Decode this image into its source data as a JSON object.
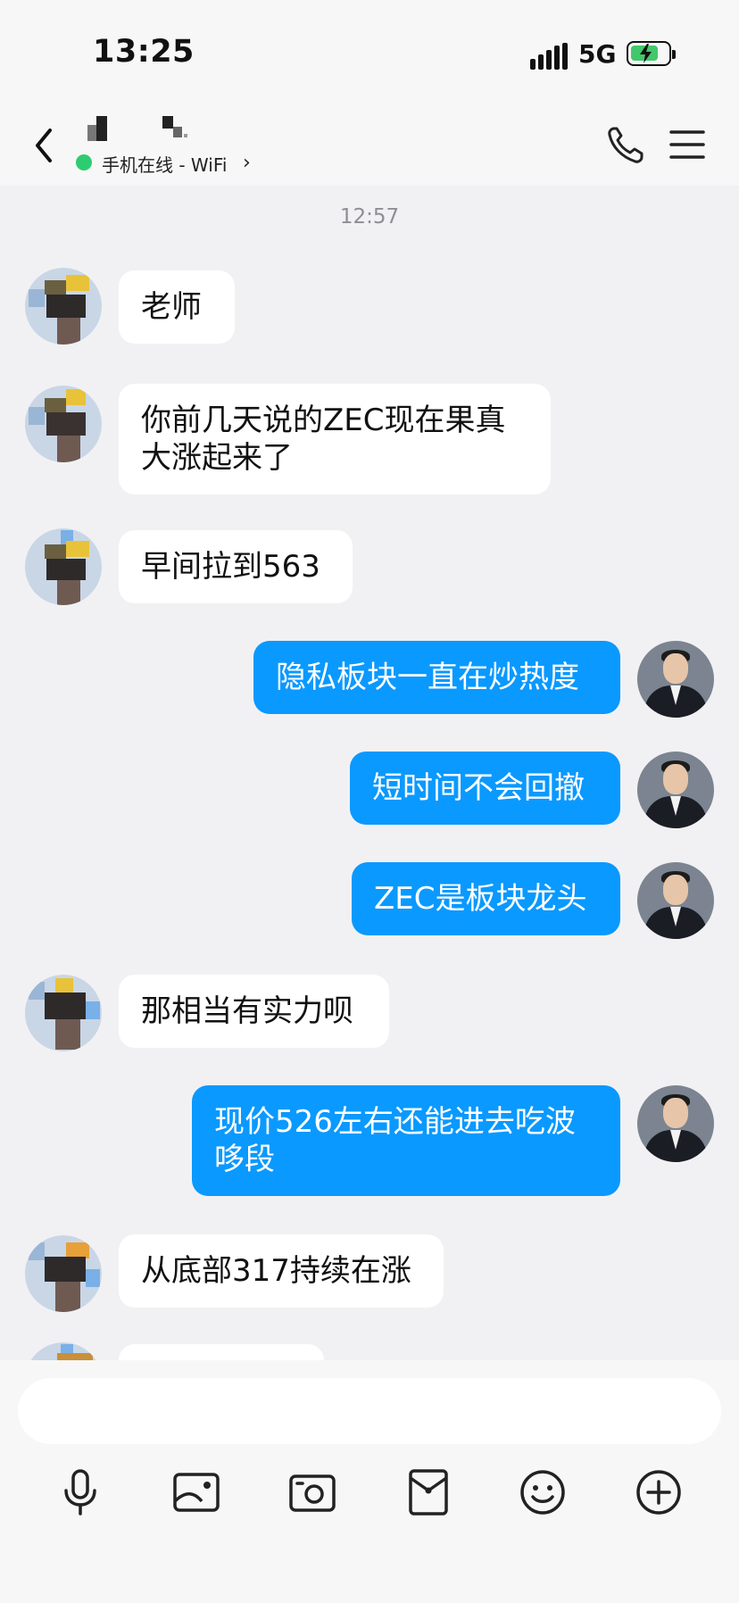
{
  "status_bar": {
    "time": "13:25",
    "network": "5G"
  },
  "header": {
    "online_status": "手机在线 - WiFi",
    "chevron": "›"
  },
  "chat": {
    "timestamp": "12:57",
    "messages": [
      {
        "from": "other",
        "text": "老师"
      },
      {
        "from": "other",
        "text": "你前几天说的ZEC现在果真\n大涨起来了"
      },
      {
        "from": "other",
        "text": "早间拉到563"
      },
      {
        "from": "me",
        "text": "隐私板块一直在炒热度"
      },
      {
        "from": "me",
        "text": "短时间不会回撤"
      },
      {
        "from": "me",
        "text": "ZEC是板块龙头"
      },
      {
        "from": "other",
        "text": "那相当有实力呗"
      },
      {
        "from": "me",
        "text": "现价526左右还能进去吃波\n哆段"
      },
      {
        "from": "other",
        "text": "从底部317持续在涨"
      },
      {
        "from": "other",
        "text": ""
      }
    ]
  },
  "input": {
    "value": "",
    "placeholder": ""
  },
  "toolbar": [
    "mic-icon",
    "image-icon",
    "camera-icon",
    "red-envelope-icon",
    "emoji-icon",
    "plus-icon"
  ],
  "colors": {
    "bubble_out": "#0a99ff",
    "bubble_in": "#ffffff",
    "online": "#2ecc71",
    "battery": "#42c86a"
  }
}
